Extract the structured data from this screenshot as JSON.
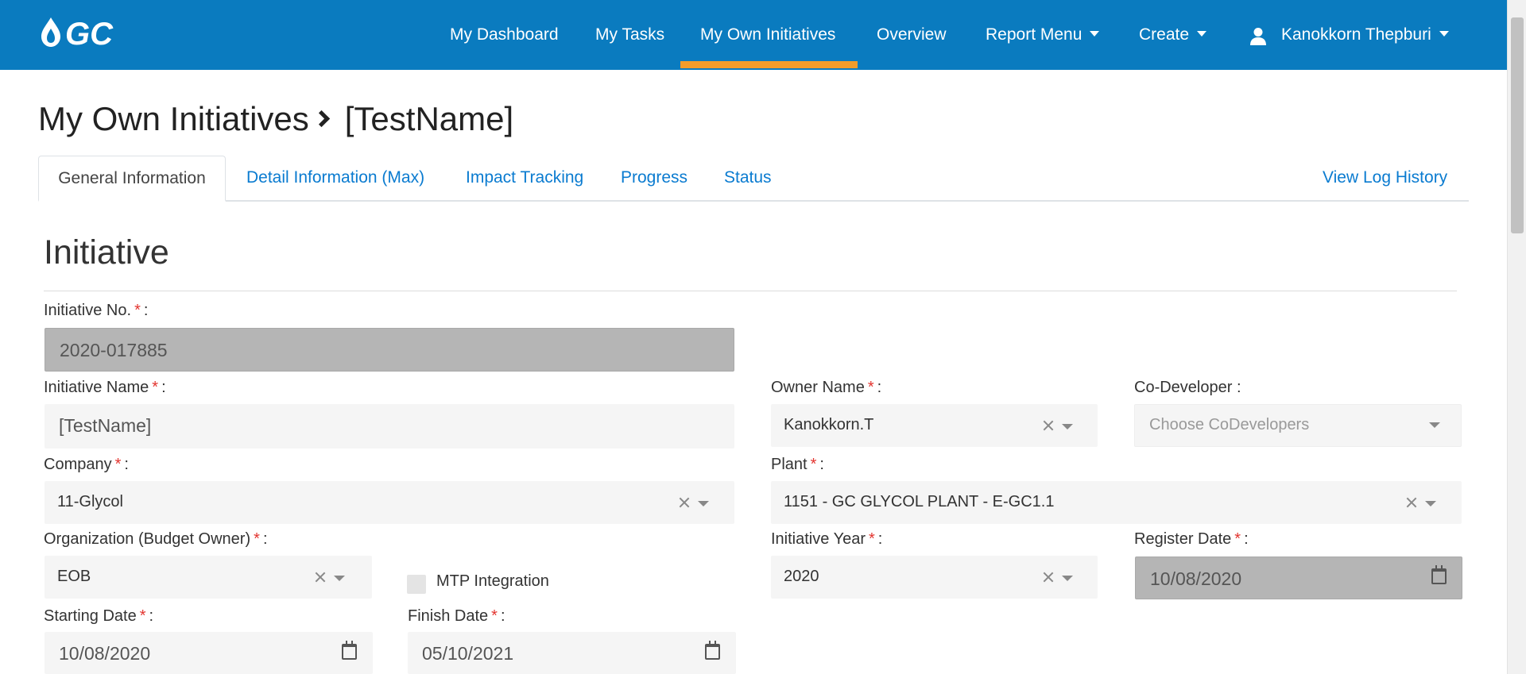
{
  "nav": {
    "logo_text": "GC",
    "items": [
      "My Dashboard",
      "My Tasks",
      "My Own Initiatives",
      "Overview",
      "Report Menu",
      "Create"
    ],
    "user": "Kanokkorn Thepburi",
    "active_color": "#f39c2a",
    "bg_color": "#0a7bbf"
  },
  "page": {
    "breadcrumb_root": "My Own Initiatives",
    "breadcrumb_current": "[TestName]"
  },
  "tabs": {
    "items": [
      "General Information",
      "Detail Information (Max)",
      "Impact Tracking",
      "Progress",
      "Status"
    ],
    "log_link": "View Log History"
  },
  "form": {
    "section_title": "Initiative",
    "required_mark": "*",
    "initiative_no": {
      "label": "Initiative No.",
      "value": "2020-017885"
    },
    "initiative_name": {
      "label": "Initiative Name",
      "value": "[TestName]"
    },
    "owner_name": {
      "label": "Owner Name",
      "value": "Kanokkorn.T"
    },
    "co_developer": {
      "label": "Co-Developer :",
      "placeholder": "Choose CoDevelopers"
    },
    "company": {
      "label": "Company",
      "value": "11-Glycol"
    },
    "plant": {
      "label": "Plant",
      "value": "1151 - GC GLYCOL PLANT - E-GC1.1"
    },
    "organization": {
      "label": "Organization (Budget Owner)",
      "value": "EOB"
    },
    "mtp": {
      "label": "MTP Integration"
    },
    "initiative_year": {
      "label": "Initiative Year",
      "value": "2020"
    },
    "register_date": {
      "label": "Register Date",
      "value": "10/08/2020"
    },
    "starting_date": {
      "label": "Starting Date",
      "value": "10/08/2020"
    },
    "finish_date": {
      "label": "Finish Date",
      "value": "05/10/2021"
    }
  }
}
